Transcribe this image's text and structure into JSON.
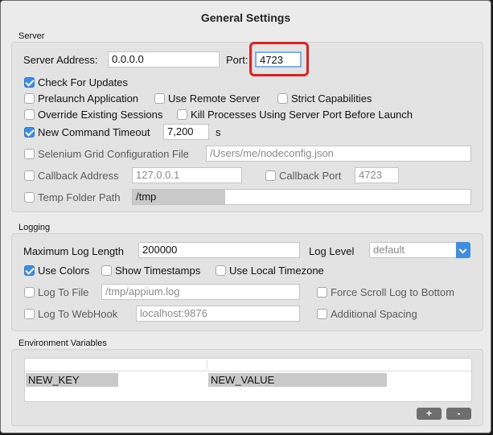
{
  "window": {
    "title": "General Settings"
  },
  "server": {
    "section_label": "Server",
    "address_label": "Server Address:",
    "address_value": "0.0.0.0",
    "port_label": "Port:",
    "port_value": "4723",
    "check_updates": {
      "label": "Check For Updates",
      "checked": true
    },
    "prelaunch": {
      "label": "Prelaunch Application",
      "checked": false
    },
    "use_remote": {
      "label": "Use Remote Server",
      "checked": false
    },
    "strict_caps": {
      "label": "Strict Capabilities",
      "checked": false
    },
    "override_sessions": {
      "label": "Override Existing Sessions",
      "checked": false
    },
    "kill_processes": {
      "label": "Kill Processes Using Server Port Before Launch",
      "checked": false
    },
    "new_cmd_timeout": {
      "label": "New Command Timeout",
      "checked": true,
      "value": "7,200",
      "unit": "s"
    },
    "selenium_grid": {
      "label": "Selenium Grid Configuration File",
      "checked": false,
      "value": "/Users/me/nodeconfig.json"
    },
    "callback_address": {
      "label": "Callback Address",
      "checked": false,
      "value": "127.0.0.1"
    },
    "callback_port": {
      "label": "Callback Port",
      "checked": false,
      "value": "4723"
    },
    "temp_folder": {
      "label": "Temp Folder Path",
      "checked": false,
      "value": "/tmp"
    }
  },
  "logging": {
    "section_label": "Logging",
    "max_log_label": "Maximum Log Length",
    "max_log_value": "200000",
    "log_level_label": "Log Level",
    "log_level_value": "default",
    "use_colors": {
      "label": "Use Colors",
      "checked": true
    },
    "show_timestamps": {
      "label": "Show Timestamps",
      "checked": false
    },
    "local_timezone": {
      "label": "Use Local Timezone",
      "checked": false
    },
    "log_to_file": {
      "label": "Log To File",
      "checked": false,
      "value": "/tmp/appium.log"
    },
    "force_scroll": {
      "label": "Force Scroll Log to Bottom",
      "checked": false
    },
    "log_to_webhook": {
      "label": "Log To WebHook",
      "checked": false,
      "value": "localhost:9876"
    },
    "additional_spacing": {
      "label": "Additional Spacing",
      "checked": false
    }
  },
  "env": {
    "section_label": "Environment Variables",
    "rows": [
      {
        "key": "NEW_KEY",
        "value": "NEW_VALUE"
      }
    ],
    "add_label": "+",
    "remove_label": "-"
  },
  "colors": {
    "accent": "#3d8de4",
    "highlight": "#e02020"
  }
}
